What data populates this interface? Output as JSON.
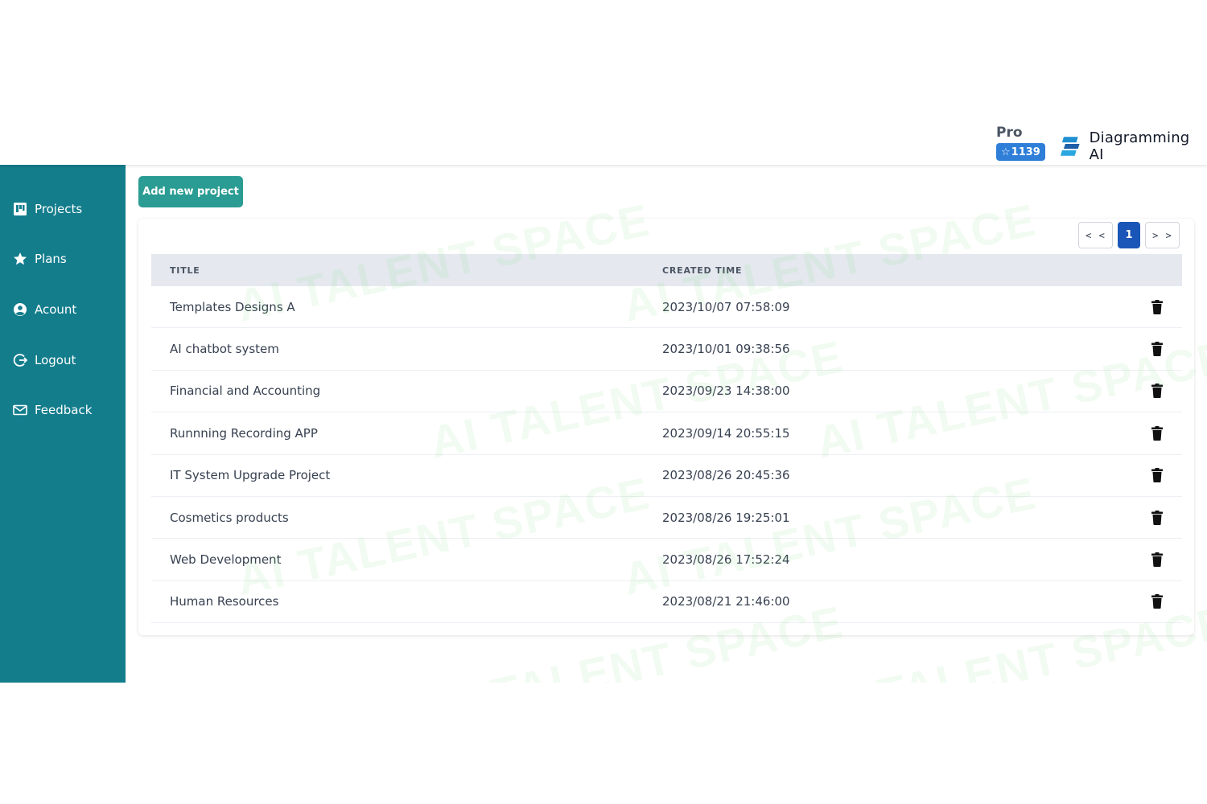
{
  "header": {
    "plan_name": "Pro",
    "credits_value": "1139",
    "credits_icon": "star-outline-icon",
    "brand_name": "Diagramming AI",
    "brand_colors": [
      "#1f8fd0",
      "#1f5fa8"
    ]
  },
  "sidebar": {
    "background": "#137d8c",
    "items": [
      {
        "label": "Projects",
        "icon": "board-icon"
      },
      {
        "label": "Plans",
        "icon": "star-icon"
      },
      {
        "label": "Acount",
        "icon": "user-circle-icon"
      },
      {
        "label": "Logout",
        "icon": "logout-icon"
      },
      {
        "label": "Feedback",
        "icon": "mail-icon"
      }
    ]
  },
  "toolbar": {
    "add_label": "Add new project",
    "accent": "#2a9c93"
  },
  "pagination": {
    "prev_label": "< <",
    "current_page": "1",
    "next_label": "> >",
    "current_color": "#1a56b8"
  },
  "table": {
    "columns": [
      "TITLE",
      "CREATED TIME"
    ],
    "rows": [
      {
        "title": "Templates Designs A",
        "created": "2023/10/07 07:58:09"
      },
      {
        "title": "AI chatbot system",
        "created": "2023/10/01 09:38:56"
      },
      {
        "title": "Financial and Accounting",
        "created": "2023/09/23 14:38:00"
      },
      {
        "title": "Runnning Recording APP",
        "created": "2023/09/14 20:55:15"
      },
      {
        "title": "IT System Upgrade Project",
        "created": "2023/08/26 20:45:36"
      },
      {
        "title": "Cosmetics products",
        "created": "2023/08/26 19:25:01"
      },
      {
        "title": "Web Development",
        "created": "2023/08/26 17:52:24"
      },
      {
        "title": "Human Resources",
        "created": "2023/08/21 21:46:00"
      }
    ],
    "row_action_icon": "trash-icon"
  },
  "watermark": {
    "text": "AI TALENT SPACE"
  }
}
